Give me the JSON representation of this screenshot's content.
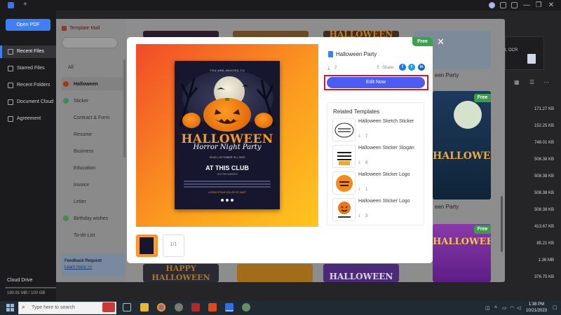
{
  "app": {
    "new_tab_symbol": "+",
    "window_controls": [
      "—",
      "❐",
      "✕"
    ]
  },
  "sidebar": {
    "open_pdf_label": "Open PDF",
    "items": [
      {
        "label": "Recent Files",
        "active": true
      },
      {
        "label": "Starred Files",
        "active": false
      },
      {
        "label": "Recent Folders",
        "active": false
      },
      {
        "label": "Document Cloud",
        "active": false
      },
      {
        "label": "Agreement",
        "active": false
      }
    ],
    "cloud": {
      "title": "Cloud Drive",
      "usage": "190.91 MB / 100 GB"
    }
  },
  "template_mall": {
    "title": "Template Mall",
    "categories": [
      "All",
      "Halloween",
      "Sticker",
      "Contract & Form",
      "Resume",
      "Business",
      "Education",
      "Invoice",
      "Letter",
      "Birthday wishes",
      "To-do List"
    ],
    "active_category": "Halloween",
    "feedback": {
      "title": "Feedback Request",
      "link": "Learn more >>"
    },
    "cards": [
      {
        "label": "een Party",
        "badge": "Free"
      },
      {
        "label": "een Party",
        "badge": "Free"
      }
    ],
    "background_titles": [
      "HALLOWEEN",
      "HALLOWEEN",
      "HALLOWEEN",
      "HAPPY HALLOWEEN",
      "HALLOWEEN"
    ]
  },
  "file_list": {
    "info_text": "t, OCR",
    "sizes": [
      "171.27 KB",
      "152.25 KB",
      "748.01 KB",
      "508.38 KB",
      "508.38 KB",
      "508.38 KB",
      "508.38 KB",
      "413.67 KB",
      "85.21 KB",
      "1.36 MB",
      "376.75 KB"
    ]
  },
  "modal": {
    "badge": "Free",
    "close_symbol": "✕",
    "template_title": "Halloween Party",
    "downloads": "2",
    "share_label": "Share:",
    "share_icons": [
      {
        "name": "facebook",
        "glyph": "f",
        "color": "#1877f2"
      },
      {
        "name": "twitter",
        "glyph": "t",
        "color": "#1d9bf0"
      },
      {
        "name": "linkedin",
        "glyph": "in",
        "color": "#0a66c2"
      }
    ],
    "edit_button": "Edit Now",
    "page_counter": "1/1",
    "poster": {
      "invited": "YOU ARE INVITED TO",
      "title": "HALLOWEEN",
      "subtitle": "Horror Night Party",
      "date": "20:00 | OCTOBER 31 | 2023",
      "club": "AT THIS CLUB",
      "address": "ON THIS ADRESS",
      "rsvp": "LOREM IPSUM DOLOR SIT AMET"
    },
    "related": {
      "title": "Related Templates",
      "items": [
        {
          "name": "Halloween Sketch Sticker",
          "count": "7"
        },
        {
          "name": "Halloween Sticker Slogan",
          "count": "8"
        },
        {
          "name": "Halloween Sticker Logo",
          "count": "1"
        },
        {
          "name": "Halloween Sticker Logo",
          "count": "3"
        }
      ]
    }
  },
  "taskbar": {
    "search_placeholder": "Type here to search",
    "time": "1:38 PM",
    "date": "10/21/2023"
  }
}
